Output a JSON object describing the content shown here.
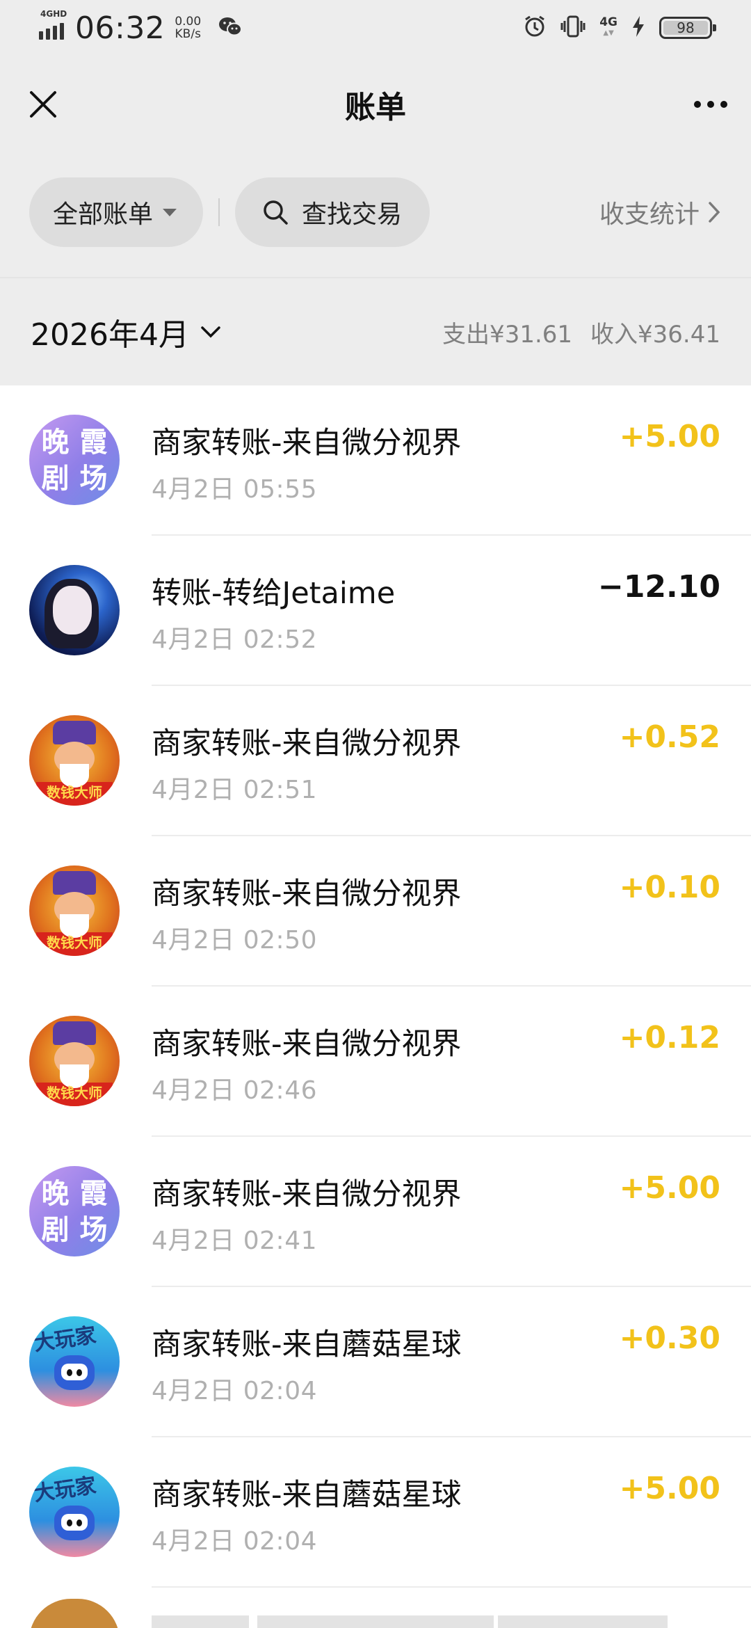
{
  "status_bar": {
    "network_tag": "4GHD",
    "time": "06:32",
    "speed_value": "0.00",
    "speed_unit": "KB/s",
    "net_type": "4G",
    "battery": "98"
  },
  "header": {
    "title": "账单"
  },
  "filters": {
    "all_bills": "全部账单",
    "search": "查找交易",
    "stats": "收支统计"
  },
  "summary": {
    "month": "2026年4月",
    "expense": "支出¥31.61",
    "income": "收入¥36.41"
  },
  "transactions": [
    {
      "name": "商家转账-来自微分视界",
      "time": "4月2日 05:55",
      "amount": "+5.00",
      "avatar_text": [
        "晚",
        "霞",
        "剧",
        "场"
      ]
    },
    {
      "name": "转账-转给Jetaime",
      "time": "4月2日 02:52",
      "amount": "−12.10"
    },
    {
      "name": "商家转账-来自微分视界",
      "time": "4月2日 02:51",
      "amount": "+0.52",
      "avatar_text": "数钱大师"
    },
    {
      "name": "商家转账-来自微分视界",
      "time": "4月2日 02:50",
      "amount": "+0.10",
      "avatar_text": "数钱大师"
    },
    {
      "name": "商家转账-来自微分视界",
      "time": "4月2日 02:46",
      "amount": "+0.12",
      "avatar_text": "数钱大师"
    },
    {
      "name": "商家转账-来自微分视界",
      "time": "4月2日 02:41",
      "amount": "+5.00",
      "avatar_text": [
        "晚",
        "霞",
        "剧",
        "场"
      ]
    },
    {
      "name": "商家转账-来自蘑菇星球",
      "time": "4月2日 02:04",
      "amount": "+0.30",
      "avatar_text": "大玩家"
    },
    {
      "name": "商家转账-来自蘑菇星球",
      "time": "4月2日 02:04",
      "amount": "+5.00",
      "avatar_text": "大玩家"
    }
  ],
  "colors": {
    "income": "#f2c21a",
    "expense": "#111111",
    "background": "#ededed"
  },
  "icons": [
    "close-icon",
    "more-icon",
    "caret-down-icon",
    "search-icon",
    "chevron-right-icon",
    "chevron-down-icon",
    "wechat-icon",
    "alarm-icon",
    "vibrate-icon",
    "charging-icon"
  ]
}
